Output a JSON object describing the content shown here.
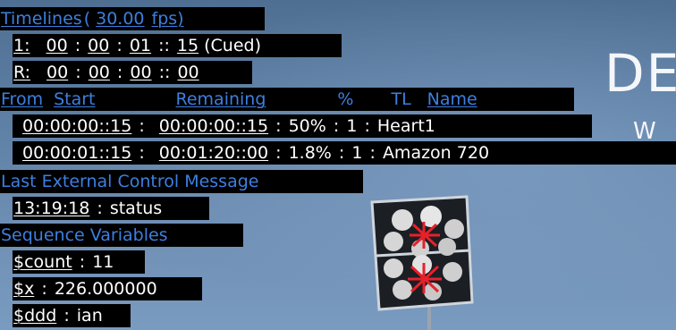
{
  "timelines_header": {
    "label": "Timelines",
    "open": "(",
    "fps": "30.00",
    "fps_unit": "fps)"
  },
  "timeline_rows": [
    {
      "index": "1:",
      "hh": "00",
      "mm": "00",
      "ss": "01",
      "ff": "15",
      "state": "(Cued)"
    },
    {
      "index": "R:",
      "hh": "00",
      "mm": "00",
      "ss": "00",
      "ff": "00",
      "state": ""
    }
  ],
  "table_header": {
    "from": "From",
    "start": "Start",
    "remaining": "Remaining",
    "percent": "%",
    "tl": "TL",
    "name": "Name"
  },
  "table_rows": [
    {
      "start": "00:00:00::15",
      "remaining": "00:00:00::15",
      "percent": "50%",
      "tl": "1",
      "name": "Heart1"
    },
    {
      "start": "00:00:01::15",
      "remaining": "00:01:20::00",
      "percent": "1.8%",
      "tl": "1",
      "name": "Amazon 720"
    }
  ],
  "last_message": {
    "label": "Last External Control Message",
    "time": "13:19:18",
    "text": "status"
  },
  "sequence_variables": {
    "label": "Sequence Variables",
    "items": [
      {
        "name": "$count",
        "value": "11"
      },
      {
        "name": "$x",
        "value": "226.000000"
      },
      {
        "name": "$ddd",
        "value": "ian"
      }
    ]
  },
  "background": {
    "title": "DE",
    "subtitle": "W"
  },
  "colors": {
    "header_blue": "#3d7fe0",
    "text": "#ffffff",
    "bar": "#000000",
    "sky": "#5d7fa4",
    "marker": "#e8202a"
  }
}
